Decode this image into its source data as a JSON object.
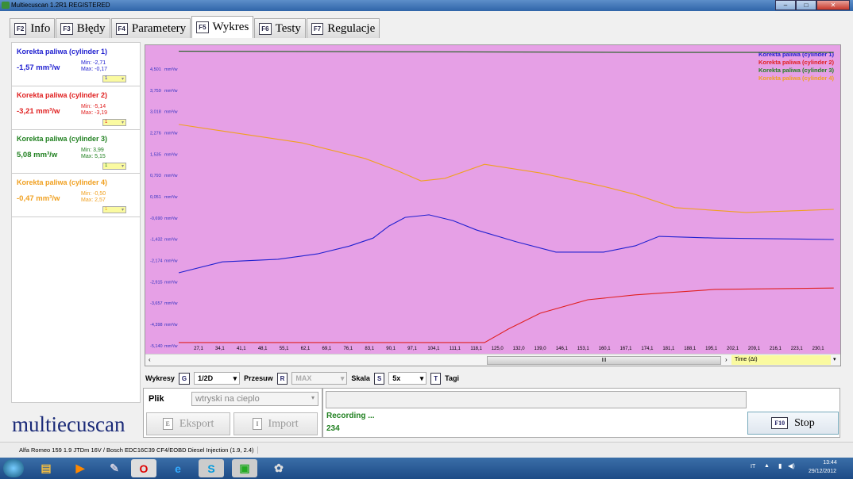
{
  "window": {
    "title": "Multiecuscan 1.2R1 REGISTERED"
  },
  "tabs": [
    {
      "key": "F2",
      "label": "Info"
    },
    {
      "key": "F3",
      "label": "Błędy"
    },
    {
      "key": "F4",
      "label": "Parametery"
    },
    {
      "key": "F5",
      "label": "Wykres",
      "active": true
    },
    {
      "key": "F6",
      "label": "Testy"
    },
    {
      "key": "F7",
      "label": "Regulacje"
    }
  ],
  "channels": [
    {
      "name": "Korekta paliwa (cylinder 1)",
      "value": "-1,57 mm³/w",
      "min": "Min: -2,71",
      "max": "Max: -0,17",
      "sel": "1",
      "color": "#2020d0"
    },
    {
      "name": "Korekta paliwa (cylinder 2)",
      "value": "-3,21 mm³/w",
      "min": "Min: -5,14",
      "max": "Max: -3,19",
      "sel": "1",
      "color": "#e02020"
    },
    {
      "name": "Korekta paliwa (cylinder 3)",
      "value": "5,08 mm³/w",
      "min": "Min: 3,99",
      "max": "Max: 5,15",
      "sel": "1",
      "color": "#208020"
    },
    {
      "name": "Korekta paliwa (cylinder 4)",
      "value": "-0,47 mm³/w",
      "min": "Min: -0,50",
      "max": "Max: 2,57",
      "sel": "1",
      "color": "#f0a020"
    }
  ],
  "chart_data": {
    "type": "line",
    "ylabel_unit": "mm³/w",
    "yticks": [
      "4,501",
      "3,759",
      "3,018",
      "2,276",
      "1,535",
      "0,793",
      "0,051",
      "-0,690",
      "-1,432",
      "-2,174",
      "-2,915",
      "-3,657",
      "-4,398",
      "-5,140"
    ],
    "ylim": [
      -5.14,
      4.501
    ],
    "xticks": [
      "27,1",
      "34,1",
      "41,1",
      "48,1",
      "55,1",
      "62,1",
      "69,1",
      "76,1",
      "83,1",
      "90,1",
      "97,1",
      "104,1",
      "111,1",
      "118,1",
      "125,0",
      "132,0",
      "139,0",
      "146,1",
      "153,1",
      "160,1",
      "167,1",
      "174,1",
      "181,1",
      "188,1",
      "195,1",
      "202,1",
      "209,1",
      "216,1",
      "223,1",
      "230,1"
    ],
    "xlabel": "Time (Δt)",
    "legend_position": "top-right",
    "series": [
      {
        "name": "Korekta paliwa (cylinder 1)",
        "color": "#2020d0",
        "points": [
          [
            20.6,
            -2.6
          ],
          [
            34.9,
            -2.22
          ],
          [
            53.1,
            -2.13
          ],
          [
            66.1,
            -1.94
          ],
          [
            76.5,
            -1.67
          ],
          [
            84.3,
            -1.39
          ],
          [
            89.5,
            -0.97
          ],
          [
            94.8,
            -0.67
          ],
          [
            102.6,
            -0.58
          ],
          [
            110.4,
            -0.78
          ],
          [
            118.2,
            -1.11
          ],
          [
            131.2,
            -1.52
          ],
          [
            144.2,
            -1.88
          ],
          [
            159.8,
            -1.88
          ],
          [
            170.2,
            -1.66
          ],
          [
            178,
            -1.33
          ],
          [
            196.2,
            -1.39
          ],
          [
            235.2,
            -1.44
          ]
        ]
      },
      {
        "name": "Korekta paliwa (cylinder 2)",
        "color": "#e02020",
        "points": [
          [
            20.6,
            -5.03
          ],
          [
            120.8,
            -5.03
          ],
          [
            128.6,
            -4.56
          ],
          [
            139,
            -4.01
          ],
          [
            154.6,
            -3.54
          ],
          [
            170.2,
            -3.37
          ],
          [
            196.2,
            -3.18
          ],
          [
            235.2,
            -3.13
          ]
        ]
      },
      {
        "name": "Korekta paliwa (cylinder 3)",
        "color": "#206020",
        "points": [
          [
            20.6,
            5.12
          ],
          [
            100,
            5.1
          ],
          [
            170,
            5.08
          ],
          [
            235.2,
            5.08
          ]
        ]
      },
      {
        "name": "Korekta paliwa (cylinder 4)",
        "color": "#f0a020",
        "points": [
          [
            20.6,
            2.57
          ],
          [
            34.9,
            2.34
          ],
          [
            60.9,
            1.93
          ],
          [
            81.7,
            1.38
          ],
          [
            92.2,
            0.96
          ],
          [
            100,
            0.6
          ],
          [
            107.8,
            0.69
          ],
          [
            120.8,
            1.18
          ],
          [
            139,
            0.88
          ],
          [
            159.8,
            0.41
          ],
          [
            170.2,
            0.13
          ],
          [
            183.2,
            -0.33
          ],
          [
            206.5,
            -0.5
          ],
          [
            235.2,
            -0.39
          ]
        ]
      }
    ]
  },
  "controls": {
    "wykresy": "Wykresy",
    "g": "G",
    "wykresy_val": "1/2D",
    "przesuw": "Przesuw",
    "r": "R",
    "przesuw_val": "MAX",
    "skala": "Skala",
    "s": "S",
    "skala_val": "5x",
    "t": "T",
    "tagi": "Tagi"
  },
  "file": {
    "label": "Plik",
    "value": "wtryski na cieplo",
    "export_key": "E",
    "export": "Eksport",
    "import_key": "I",
    "import": "Import"
  },
  "status": {
    "text": "Recording ...",
    "count": "234",
    "stop_key": "F10",
    "stop": "Stop"
  },
  "logo": "multiecuscan",
  "statusbar": "Alfa Romeo 159 1.9 JTDm 16V / Bosch EDC16C39 CF4/EOBD Diesel Injection (1.9, 2.4)",
  "tray": {
    "lang": "IT",
    "time": "13:44",
    "date": "29/12/2012"
  },
  "scroll": {
    "thumb": "III",
    "left": "‹",
    "right": "›"
  }
}
